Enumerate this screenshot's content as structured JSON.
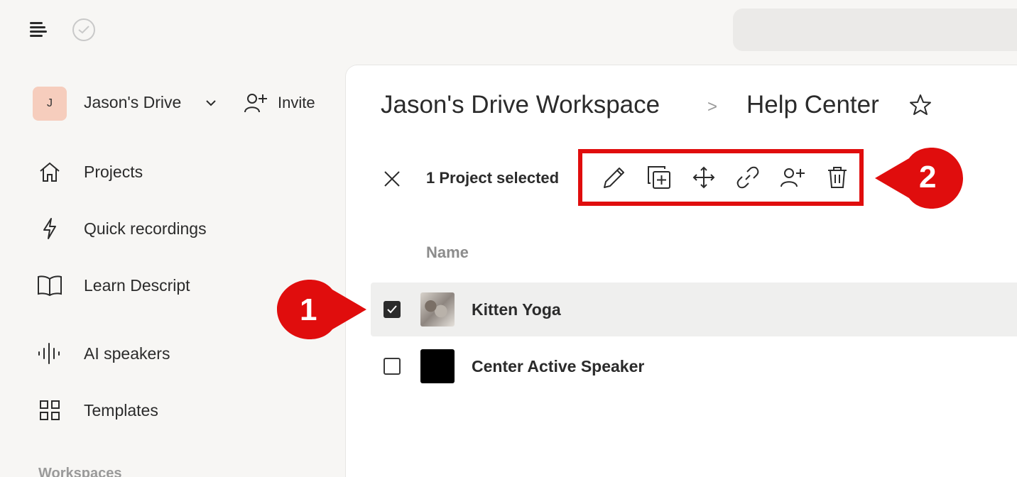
{
  "topbar": {
    "logo_icon": "descript-logo-icon",
    "status_icon": "check-circle-icon"
  },
  "sidebar": {
    "avatar_initial": "J",
    "drive_name": "Jason's Drive",
    "invite_label": "Invite",
    "items": [
      {
        "label": "Projects",
        "icon": "home-icon"
      },
      {
        "label": "Quick recordings",
        "icon": "lightning-icon"
      },
      {
        "label": "Learn Descript",
        "icon": "book-icon"
      },
      {
        "label": "AI speakers",
        "icon": "waveform-icon"
      },
      {
        "label": "Templates",
        "icon": "grid-icon"
      }
    ],
    "section_label": "Workspaces"
  },
  "main": {
    "breadcrumb": [
      "Jason's Drive Workspace",
      "Help Center"
    ],
    "breadcrumb_separator": ">",
    "selection_text": "1 Project selected",
    "toolbar_icons": [
      "edit-icon",
      "duplicate-icon",
      "move-icon",
      "link-icon",
      "add-person-icon",
      "trash-icon"
    ],
    "column_header": "Name",
    "rows": [
      {
        "title": "Kitten Yoga",
        "checked": true
      },
      {
        "title": "Center Active Speaker",
        "checked": false
      }
    ]
  },
  "callouts": [
    "1",
    "2"
  ],
  "colors": {
    "callout_red": "#e00d0d",
    "avatar_bg": "#f6cdbd",
    "selected_row_bg": "#efefee"
  }
}
